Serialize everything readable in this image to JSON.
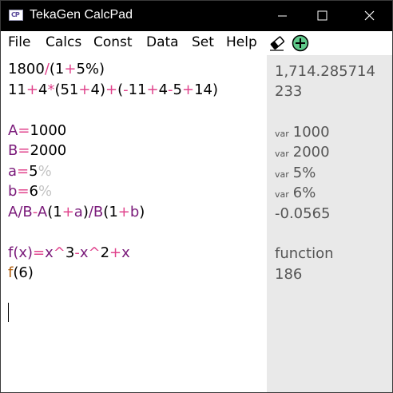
{
  "window": {
    "title": "TekaGen CalcPad",
    "icon_label": "CP"
  },
  "menu": {
    "file": "File",
    "calcs": "Calcs",
    "const": "Const",
    "data": "Data",
    "set": "Set",
    "help": "Help"
  },
  "editor": {
    "l1": [
      "1800",
      "/",
      "(",
      "1",
      "+",
      "5%",
      ")"
    ],
    "l2": [
      "11",
      "+",
      "4",
      "*",
      "(",
      "51",
      "+",
      "4",
      ")",
      "+",
      "(",
      "-",
      "11",
      "+",
      "4",
      "-",
      "5",
      "+",
      "14",
      ")"
    ],
    "l3": [
      "A",
      "=",
      "1000"
    ],
    "l4": [
      "B",
      "=",
      "2000"
    ],
    "l5": [
      "a",
      "=",
      "5",
      "%"
    ],
    "l6": [
      "b",
      "=",
      "6",
      "%"
    ],
    "l7": [
      "A",
      "/",
      "B",
      "-",
      "A",
      "(",
      "1",
      "+",
      "a",
      ")",
      "/",
      "B",
      "(",
      "1",
      "+",
      "b",
      ")"
    ],
    "l8": [
      "f(x)",
      "=",
      "x",
      "^",
      "3",
      "-",
      "x",
      "^",
      "2",
      "+",
      "x"
    ],
    "l9": [
      "f",
      "(6)"
    ]
  },
  "results": {
    "r1": "1,714.285714",
    "r2": "233",
    "r3_tag": "var",
    "r3": "1000",
    "r4_tag": "var",
    "r4": "2000",
    "r5_tag": "var",
    "r5": "5%",
    "r6_tag": "var",
    "r6": "6%",
    "r7": "-0.0565",
    "r8": "function",
    "r9": "186"
  },
  "colors": {
    "operator": "#e0438c",
    "variable": "#7a1a7a",
    "percent": "#c4c4c4",
    "function_call": "#b06010",
    "results_bg": "#e9e9e9",
    "add_icon": "#5fc98a"
  },
  "icons": {
    "eraser": "eraser-icon",
    "add": "add-circle-icon",
    "minimize": "minimize-icon",
    "maximize": "maximize-icon",
    "close": "close-icon"
  }
}
